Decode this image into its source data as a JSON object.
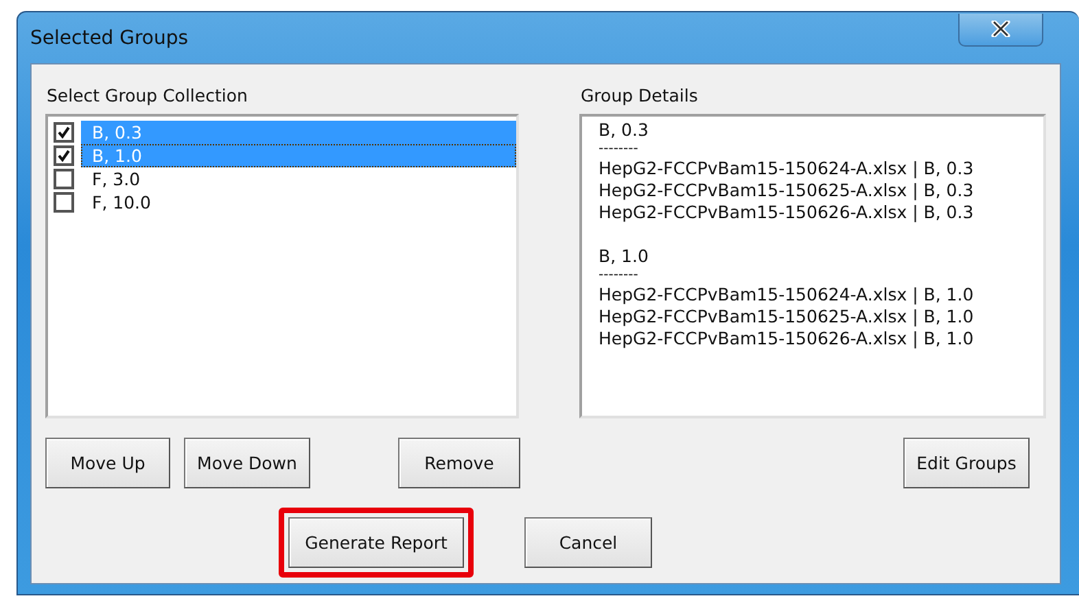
{
  "window": {
    "title": "Selected Groups"
  },
  "collection": {
    "label": "Select Group Collection",
    "items": [
      {
        "label": "B, 0.3",
        "checked": true,
        "selected": true,
        "focused": false
      },
      {
        "label": "B, 1.0",
        "checked": true,
        "selected": true,
        "focused": true
      },
      {
        "label": "F, 3.0",
        "checked": false,
        "selected": false,
        "focused": false
      },
      {
        "label": "F, 10.0",
        "checked": false,
        "selected": false,
        "focused": false
      }
    ]
  },
  "details": {
    "label": "Group Details",
    "groups": [
      {
        "title": "B, 0.3",
        "separator": "--------",
        "files": [
          "HepG2-FCCPvBam15-150624-A.xlsx | B, 0.3",
          "HepG2-FCCPvBam15-150625-A.xlsx | B, 0.3",
          "HepG2-FCCPvBam15-150626-A.xlsx | B, 0.3"
        ]
      },
      {
        "title": "B, 1.0",
        "separator": "--------",
        "files": [
          "HepG2-FCCPvBam15-150624-A.xlsx | B, 1.0",
          "HepG2-FCCPvBam15-150625-A.xlsx | B, 1.0",
          "HepG2-FCCPvBam15-150626-A.xlsx | B, 1.0"
        ]
      }
    ]
  },
  "list_buttons": [
    "Move Up",
    "Move Down",
    "Remove"
  ],
  "detail_buttons": [
    "Edit Groups"
  ],
  "footer_buttons": [
    {
      "label": "Generate Report",
      "highlighted": true
    },
    {
      "label": "Cancel",
      "highlighted": false
    }
  ]
}
